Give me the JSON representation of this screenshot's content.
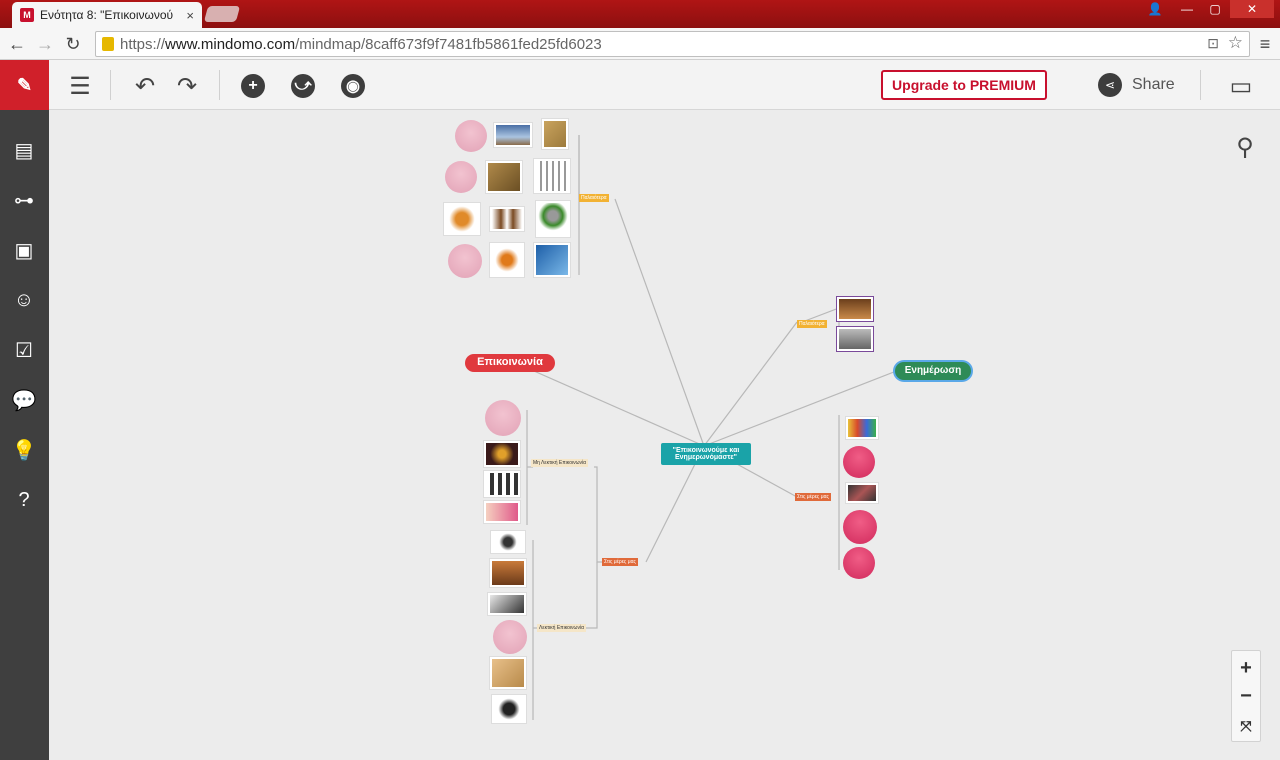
{
  "browser": {
    "tab_title": "Ενότητα 8: \"Επικοινωνού",
    "tab_close": "×",
    "url_prefix": "https://",
    "url_host": "www.mindomo.com",
    "url_path": "/mindmap/8caff673f9f7481fb5861fed25fd6023",
    "window_minimize": "—",
    "window_maximize": "▢",
    "window_close": "✕"
  },
  "toolbar": {
    "upgrade_label": "Upgrade to PREMIUM",
    "share_label": "Share"
  },
  "mindmap": {
    "central_topic": "\"Επικοινωνούμε και Ενημερωνόμαστε\"",
    "main_left": "Επικοινωνία",
    "main_right": "Ενημέρωση",
    "sub_past_top": "Παλαιότερα",
    "sub_past_right": "Παλαιότερα",
    "sub_today_left": "Στις μέρες μας",
    "sub_today_right": "Στις μέρες μας",
    "sub_nonverbal": "Μη Λεκτική Επικοινωνία",
    "sub_verbal": "Λεκτική Επικοινωνία"
  },
  "colors": {
    "central": "#1aa3a8",
    "communication": "#e0393e",
    "information": "#2e8b57",
    "past": "#f2b233",
    "today": "#e06a3a",
    "brand_red": "#c8102e"
  },
  "icons": {
    "sidebar": [
      "outline-icon",
      "link-icon",
      "image-icon",
      "emoji-icon",
      "task-icon",
      "comments-icon",
      "idea-icon",
      "help-icon"
    ],
    "toolbar": [
      "menu-icon",
      "undo-icon",
      "redo-icon",
      "add-topic-icon",
      "relationship-icon",
      "theme-icon",
      "share-icon",
      "presentation-icon"
    ]
  }
}
